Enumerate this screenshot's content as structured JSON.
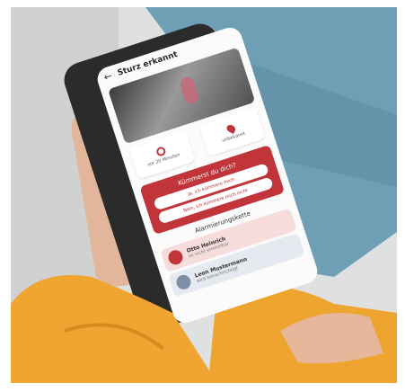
{
  "app": {
    "screen_title": "Sturz erkannt"
  },
  "info_cards": [
    {
      "icon": "clock-icon",
      "label": "vor 20 Minuten"
    },
    {
      "icon": "location-pin-icon",
      "label": "unbekannt"
    }
  ],
  "question": {
    "title": "Kümmerst du dich?",
    "options": [
      "Ja, ich kümmere mich",
      "Nein, ich kümmere mich nicht"
    ]
  },
  "alarm_chain": {
    "title": "Alarmierungskette",
    "contacts": [
      {
        "name": "Otto Heinrich",
        "status": "ist nicht erreichbar"
      },
      {
        "name": "Leon Mustermann",
        "status": "wird benachrichtigt"
      }
    ]
  },
  "colors": {
    "accent_red": "#c0343a",
    "sweater_orange": "#f0a432",
    "jeans_blue": "#6f9fb4",
    "sofa_gray": "#d9dcda"
  }
}
